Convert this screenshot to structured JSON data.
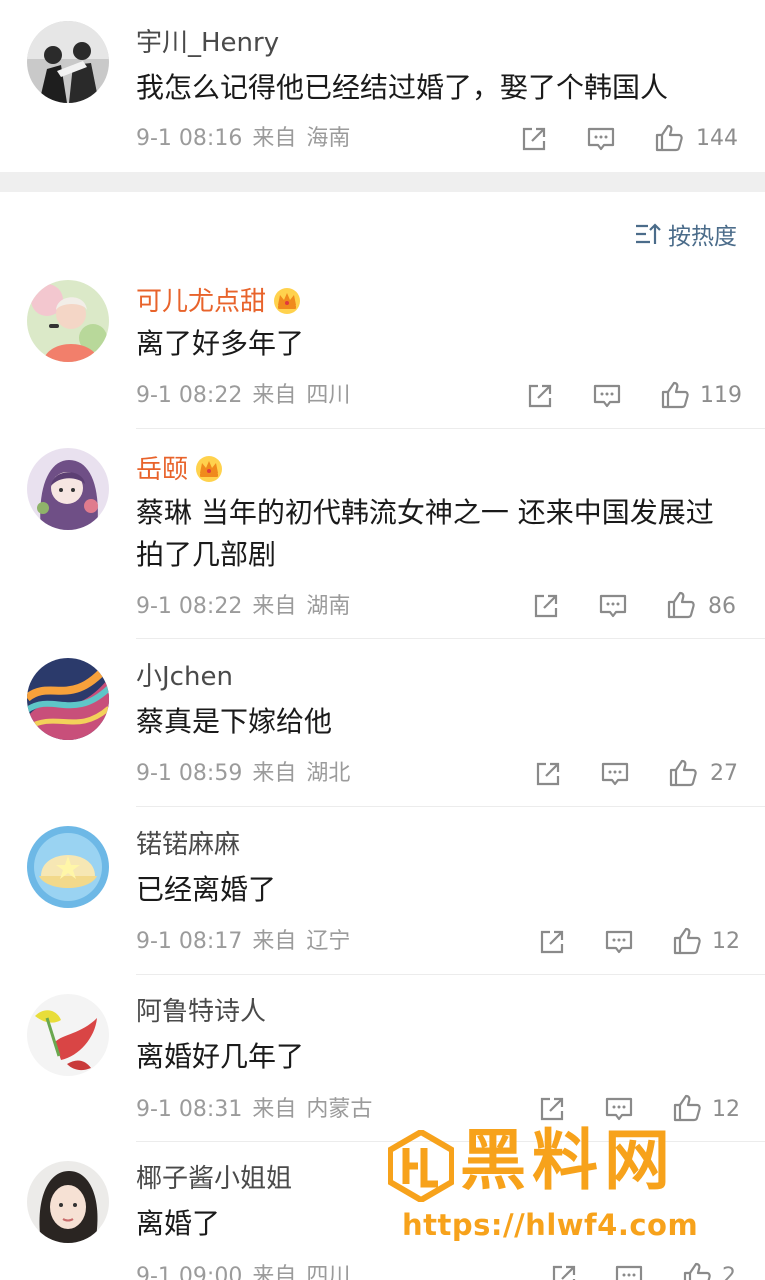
{
  "top_comment": {
    "username": "宇川_Henry",
    "text": "我怎么记得他已经结过婚了，娶了个韩国人",
    "time": "9-1 08:16",
    "from_label": "来自",
    "location": "海南",
    "likes": "144"
  },
  "sort": {
    "label": "按热度",
    "icon": "sort-icon"
  },
  "replies": [
    {
      "username": "可儿尤点甜",
      "vip": true,
      "text": "离了好多年了",
      "time": "9-1 08:22",
      "from_label": "来自",
      "location": "四川",
      "likes": "119"
    },
    {
      "username": "岳颐",
      "vip": true,
      "text": "蔡琳 当年的初代韩流女神之一 还来中国发展过拍了几部剧",
      "time": "9-1 08:22",
      "from_label": "来自",
      "location": "湖南",
      "likes": "86"
    },
    {
      "username": "小Jchen",
      "vip": false,
      "text": "蔡真是下嫁给他",
      "time": "9-1 08:59",
      "from_label": "来自",
      "location": "湖北",
      "likes": "27"
    },
    {
      "username": "锘锘麻麻",
      "vip": false,
      "text": "已经离婚了",
      "time": "9-1 08:17",
      "from_label": "来自",
      "location": "辽宁",
      "likes": "12"
    },
    {
      "username": "阿鲁特诗人",
      "vip": false,
      "text": "离婚好几年了",
      "time": "9-1 08:31",
      "from_label": "来自",
      "location": "内蒙古",
      "likes": "12"
    },
    {
      "username": "椰子酱小姐姐",
      "vip": false,
      "text": "离婚了",
      "time": "9-1 09:00",
      "from_label": "来自",
      "location": "四川",
      "likes": "2"
    }
  ],
  "watermark": {
    "title": "黑料网",
    "url": "https://hlwf4.com"
  },
  "colors": {
    "vip_name": "#e8632b",
    "normal_name": "#4a4a4a",
    "meta": "#9b9b9b",
    "sort_blue": "#4b6c8a",
    "watermark": "#f7a21b"
  }
}
